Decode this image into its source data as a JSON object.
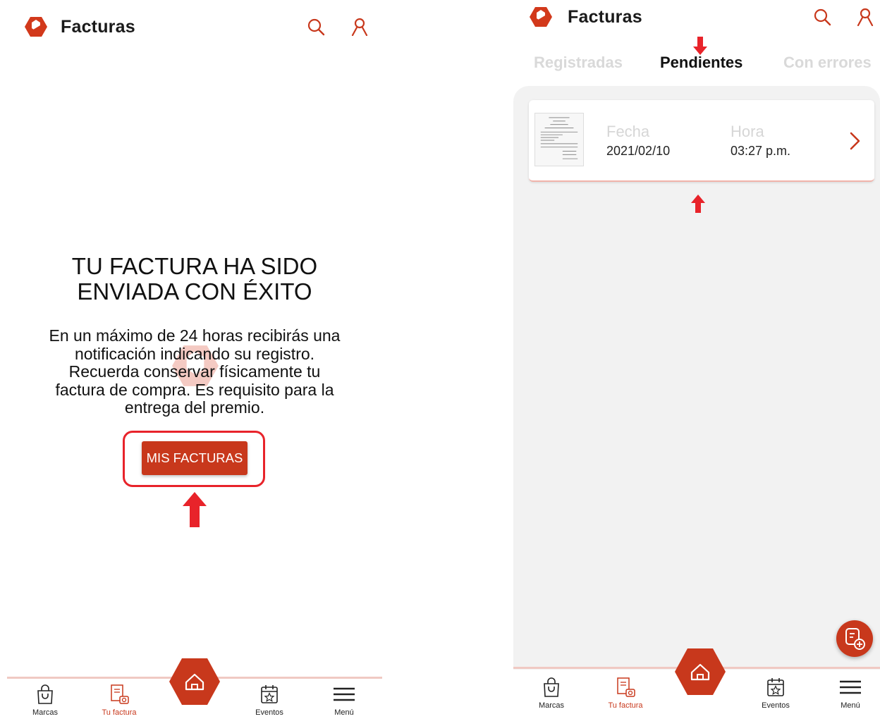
{
  "left": {
    "header": {
      "title": "Facturas"
    },
    "success": {
      "title_line1": "TU FACTURA HA SIDO",
      "title_line2": "ENVIADA CON ÉXITO",
      "body": "En un máximo de 24 horas recibirás una notificación indicando su registro. Recuerda conservar físicamente tu factura de compra. Es requisito para la entrega del premio."
    },
    "button": {
      "label": "MIS FACTURAS"
    },
    "nav": {
      "marcas": "Marcas",
      "tu_factura": "Tu factura",
      "eventos": "Eventos",
      "menu": "Menú"
    }
  },
  "right": {
    "header": {
      "title": "Facturas"
    },
    "tabs": [
      {
        "label": "Registradas",
        "active": false
      },
      {
        "label": "Pendientes",
        "active": true
      },
      {
        "label": "Con errores",
        "active": false
      }
    ],
    "invoice": {
      "fecha_label": "Fecha",
      "fecha_value": "2021/02/10",
      "hora_label": "Hora",
      "hora_value": "03:27 p.m."
    },
    "nav": {
      "marcas": "Marcas",
      "tu_factura": "Tu factura",
      "eventos": "Eventos",
      "menu": "Menú"
    }
  },
  "colors": {
    "brand_red": "#c8381c",
    "annotation_red": "#e8232a",
    "inactive_tab": "#d9d9d9",
    "list_background": "#f2f2f2"
  },
  "icons": [
    "logo-icon",
    "search-icon",
    "user-icon",
    "home-icon",
    "shopping-bag-icon",
    "invoice-camera-icon",
    "calendar-star-icon",
    "menu-icon",
    "chevron-right-icon",
    "add-invoice-icon",
    "arrow-up-icon",
    "arrow-down-icon"
  ]
}
